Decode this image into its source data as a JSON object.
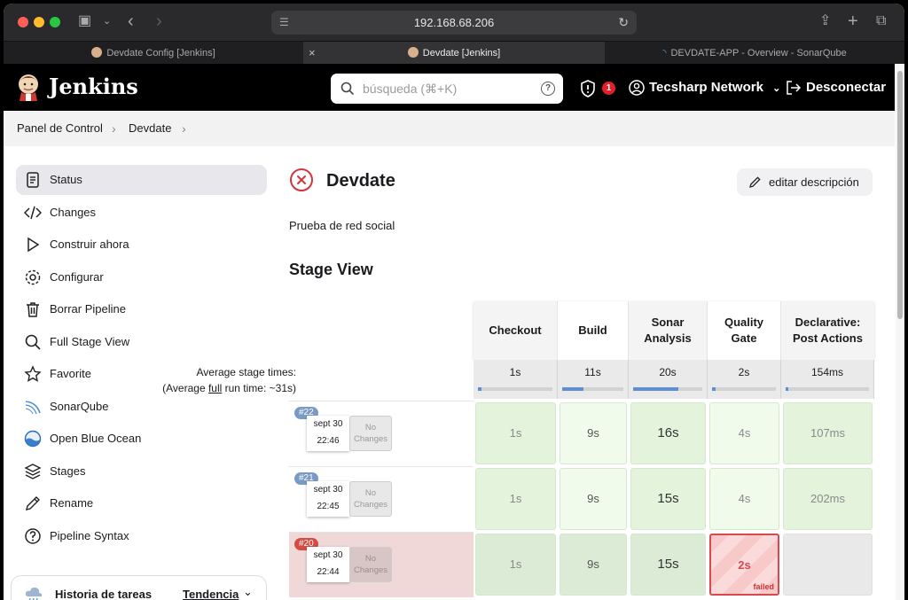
{
  "browser": {
    "url": "192.168.68.206",
    "tabs": [
      {
        "title": "Devdate Config [Jenkins]",
        "active": false
      },
      {
        "title": "Devdate [Jenkins]",
        "active": true
      },
      {
        "title": "DEVDATE-APP - Overview - SonarQube",
        "active": false
      }
    ]
  },
  "header": {
    "brand": "Jenkins",
    "search_placeholder": "búsqueda (⌘+K)",
    "notification_count": "1",
    "user": "Tecsharp Network",
    "logout": "Desconectar"
  },
  "breadcrumb": [
    "Panel de Control",
    "Devdate"
  ],
  "sidebar": {
    "items": [
      {
        "label": "Status",
        "icon": "status-icon",
        "active": true
      },
      {
        "label": "Changes",
        "icon": "code-icon"
      },
      {
        "label": "Construir ahora",
        "icon": "play-icon"
      },
      {
        "label": "Configurar",
        "icon": "gear-icon"
      },
      {
        "label": "Borrar Pipeline",
        "icon": "trash-icon"
      },
      {
        "label": "Full Stage View",
        "icon": "search-icon"
      },
      {
        "label": "Favorite",
        "icon": "star-icon"
      },
      {
        "label": "SonarQube",
        "icon": "sonarqube-icon"
      },
      {
        "label": "Open Blue Ocean",
        "icon": "blue-ocean-icon"
      },
      {
        "label": "Stages",
        "icon": "layers-icon"
      },
      {
        "label": "Rename",
        "icon": "pencil-icon"
      },
      {
        "label": "Pipeline Syntax",
        "icon": "help-icon"
      }
    ],
    "history_title": "Historia de tareas",
    "history_trend": "Tendencia"
  },
  "main": {
    "title": "Devdate",
    "edit_label": "editar descripción",
    "description": "Prueba de red social",
    "stage_view_title": "Stage View"
  },
  "stage_view": {
    "avg_label": "Average stage times:",
    "avg_full_prefix": "(Average ",
    "avg_full_word": "full",
    "avg_full_suffix": " run time: ~31s)",
    "stages": [
      {
        "name_1": "Checkout",
        "name_2": "",
        "avg": "1s",
        "avg_fraction": 0.05
      },
      {
        "name_1": "Build",
        "name_2": "",
        "avg": "11s",
        "avg_fraction": 0.35
      },
      {
        "name_1": "Sonar",
        "name_2": "Analysis",
        "avg": "20s",
        "avg_fraction": 0.65
      },
      {
        "name_1": "Quality",
        "name_2": "Gate",
        "avg": "2s",
        "avg_fraction": 0.06
      },
      {
        "name_1": "Declarative:",
        "name_2": "Post Actions",
        "avg": "154ms",
        "avg_fraction": 0.02
      }
    ],
    "runs": [
      {
        "id": "#22",
        "date": "sept 30",
        "time": "22:46",
        "changes": "No Changes",
        "failed": false,
        "cells": [
          "1s",
          "9s",
          "16s",
          "4s",
          "107ms"
        ]
      },
      {
        "id": "#21",
        "date": "sept 30",
        "time": "22:45",
        "changes": "No Changes",
        "failed": false,
        "cells": [
          "1s",
          "9s",
          "15s",
          "4s",
          "202ms"
        ]
      },
      {
        "id": "#20",
        "date": "sept 30",
        "time": "22:44",
        "changes": "No Changes",
        "failed": true,
        "cells": [
          "1s",
          "9s",
          "15s",
          "2s",
          ""
        ],
        "failed_label": "failed"
      }
    ]
  },
  "colors": {
    "success": "#e2f3dc",
    "fail": "#d9484f",
    "accent": "#5b8fd6"
  }
}
